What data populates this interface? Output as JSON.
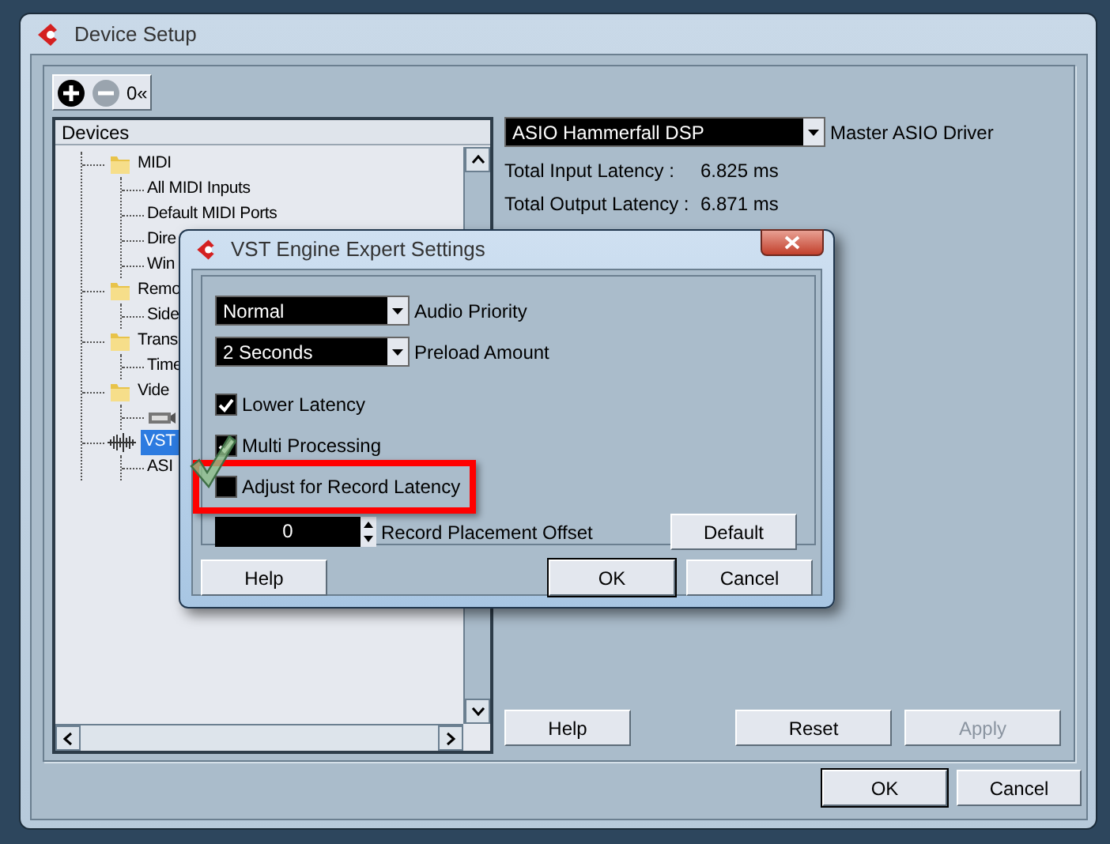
{
  "window": {
    "title": "Device Setup"
  },
  "toolbar": [
    {
      "kind": "add",
      "disabled": false
    },
    {
      "kind": "remove",
      "disabled": true
    },
    {
      "kind": "reset",
      "label": "0«",
      "disabled": false
    }
  ],
  "devices": {
    "header": "Devices",
    "tree": [
      {
        "label": "MIDI",
        "kind": "folder",
        "selected": false,
        "children": [
          {
            "label": "All MIDI Inputs",
            "selected": false
          },
          {
            "label": "Default MIDI Ports",
            "selected": false
          },
          {
            "label": "Dire",
            "selected": false
          },
          {
            "label": "Win",
            "selected": false
          }
        ]
      },
      {
        "label": "Remo",
        "kind": "folder",
        "selected": false,
        "children": [
          {
            "label": "Side",
            "selected": false
          }
        ]
      },
      {
        "label": "Trans",
        "kind": "folder",
        "selected": false,
        "children": [
          {
            "label": "Time",
            "selected": false
          }
        ]
      },
      {
        "label": "Vide",
        "kind": "folder",
        "selected": false,
        "children": [
          {
            "kind": "device",
            "selected": false
          }
        ]
      },
      {
        "label": "VST",
        "kind": "audio",
        "selected": true,
        "children": [
          {
            "label": "ASI",
            "selected": false
          }
        ]
      }
    ]
  },
  "settings": {
    "driver": {
      "value": "ASIO Hammerfall DSP",
      "label": "Master ASIO Driver"
    },
    "latencies": [
      {
        "label": "Total Input Latency :",
        "value": "6.825 ms"
      },
      {
        "label": "Total Output Latency :",
        "value": "6.871 ms"
      }
    ],
    "buttons": [
      {
        "label": "Help",
        "disabled": false
      },
      {
        "label": "Reset",
        "disabled": false
      },
      {
        "label": "Apply",
        "disabled": true
      }
    ]
  },
  "footer": [
    {
      "label": "OK",
      "default": true
    },
    {
      "label": "Cancel",
      "default": false
    }
  ],
  "dialog": {
    "title": "VST Engine Expert Settings",
    "selects": [
      {
        "value": "Normal",
        "label": "Audio Priority"
      },
      {
        "value": "2 Seconds",
        "label": "Preload Amount"
      }
    ],
    "checkboxes": [
      {
        "label": "Lower Latency",
        "checked": true,
        "highlighted": false
      },
      {
        "label": "Multi Processing",
        "checked": true,
        "highlighted": false
      },
      {
        "label": "Adjust for Record Latency",
        "checked": false,
        "highlighted": true
      }
    ],
    "offset": {
      "value": "0",
      "label": "Record Placement Offset"
    },
    "default_button": "Default",
    "buttons": [
      {
        "label": "Help",
        "default": false
      },
      {
        "label": "OK",
        "default": true
      },
      {
        "label": "Cancel",
        "default": false
      }
    ]
  }
}
